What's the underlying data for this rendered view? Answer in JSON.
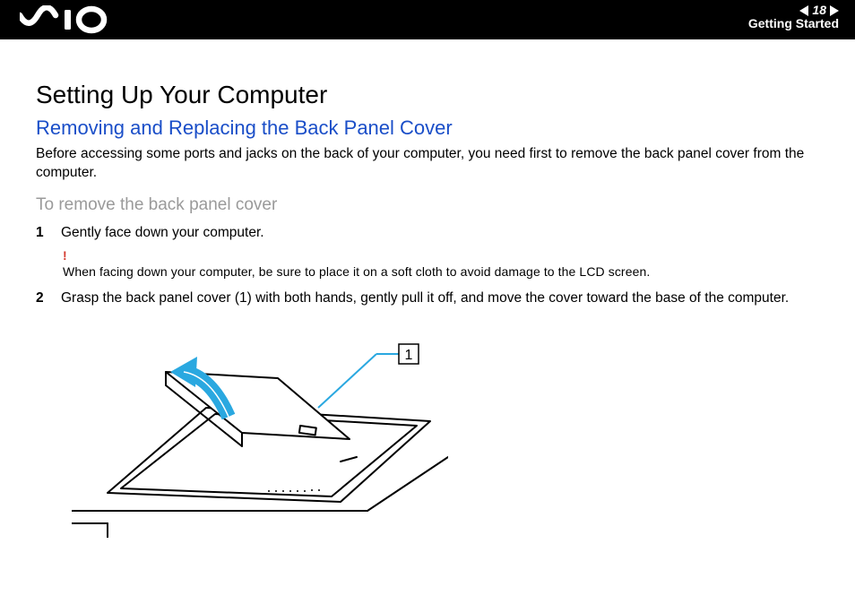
{
  "header": {
    "page_number": "18",
    "section_label": "Getting Started"
  },
  "content": {
    "page_title": "Setting Up Your Computer",
    "section_title": "Removing and Replacing the Back Panel Cover",
    "intro": "Before accessing some ports and jacks on the back of your computer, you need first to remove the back panel cover from the computer.",
    "sub_title": "To remove the back panel cover",
    "steps": [
      {
        "num": "1",
        "text": "Gently face down your computer."
      },
      {
        "num": "2",
        "text": "Grasp the back panel cover (1) with both hands, gently pull it off, and move the cover toward the base of the computer."
      }
    ],
    "warning": {
      "mark": "!",
      "text": "When facing down your computer, be sure to place it on a soft cloth to avoid damage to the LCD screen."
    },
    "figure_callout": "1"
  }
}
